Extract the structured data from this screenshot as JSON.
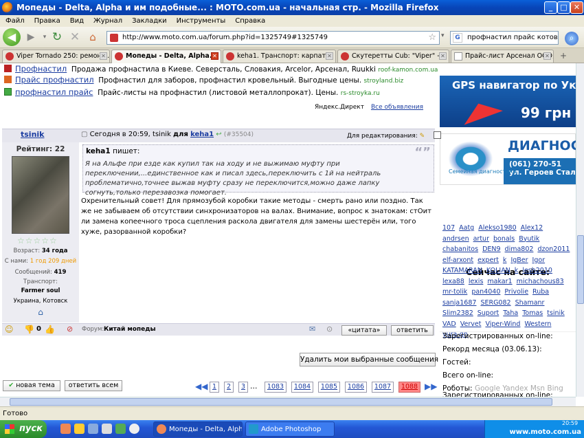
{
  "window": {
    "title": "Мопеды - Delta, Alpha и им подобные... : MOTO.com.ua - начальная стр. - Mozilla Firefox",
    "min": "_",
    "max": "□",
    "close": "✕"
  },
  "menu": [
    "Файл",
    "Правка",
    "Вид",
    "Журнал",
    "Закладки",
    "Инструменты",
    "Справка"
  ],
  "nav": {
    "url": "http://www.moto.com.ua/forum.php?id=1325749#1325749",
    "search": "профнастил прайс котовск",
    "search_engine": "G"
  },
  "tabs": [
    {
      "label": "Viper Tornado 250: ремонт..."
    },
    {
      "label": "Мопеды - Delta, Alpha..."
    },
    {
      "label": "keha1. Транспорт: карпат..."
    },
    {
      "label": "Скутеретты Cub: \"Viper\" -..."
    },
    {
      "label": "Прайс-лист Арсенал ООО,..."
    }
  ],
  "tab_new": "+",
  "ads": [
    {
      "link": "Профнастил",
      "text": "Продажа профнастила в Киеве. Северсталь, Словакия, Arcelor, Арсенал, Ruukki",
      "src": "roof-kamon.com.ua"
    },
    {
      "link": "Прайс профнастил",
      "text": "Профнастил для заборов, профнастил кровельный. Выгодные цены.",
      "src": "stroyland.biz"
    },
    {
      "link": "профнастил прайс",
      "text": "Прайс-листы на профнастил (листовой металлопрокат). Цены.",
      "src": "rs-stroyka.ru"
    }
  ],
  "direct": {
    "label": "Яндекс.Директ",
    "all": "Все объявления"
  },
  "banners": {
    "gps_title": "GPS навигатор по Ук",
    "gps_price": "99 грн",
    "diag_title": "ДИАГНОС",
    "diag_phone": "(061) 270-51",
    "diag_addr": "ул. Героев Стали",
    "diag_sub": "Семейная диагностики"
  },
  "post": {
    "author": "tsinik",
    "date_prefix": "Сегодня в 20:59, tsinik",
    "for": "для",
    "to": "keha1",
    "id": "(#35504)",
    "edit_label": "Для редактирования:",
    "rating_label": "Рейтинг:",
    "rating": "22",
    "stars": "☆☆☆☆☆",
    "age_label": "Возраст:",
    "age": "34 года",
    "since_label": "С нами:",
    "since": "1 год 209 дней",
    "msgs_label": "Сообщений:",
    "msgs": "419",
    "transport_label": "Транспорт:",
    "transport": "Farmer soul",
    "location": "Украина, Котовск",
    "quote_author": "keha1",
    "quote_said": "пишет:",
    "quote_text": "Я на Альфе при езде как купил так на ходу и не выжимаю муфту при переключении,...единственное как и писал здесь,переключить с 1й на нейтраль проблематично,точнее выжав муфту сразу не переключится,можно даже лапку согнуть,только перезавозка помогает.",
    "text": "Охренительный совет! Для прямозубой коробки такие методы - смерть рано или поздно. Так же не забываем об отсутствии синхронизаторов на валах. Внимание, вопрос к знатокам: стОит ли замена копеечного троса сцепления раскола двигателя для замены шестерён или, того хуже, разорванной коробки?",
    "votes": "0",
    "forum_label": "Форум:",
    "forum": "Китай мопеды",
    "btn_quote": "«цитата»",
    "btn_reply": "ответить"
  },
  "delete_btn": "Удалить мои выбранные сообщения",
  "bottom_buttons": {
    "new_topic": "новая тема",
    "reply_all": "ответить всем"
  },
  "pager": [
    "1",
    "2",
    "3",
    "...",
    "1083",
    "1084",
    "1085",
    "1086",
    "1087",
    "1088"
  ],
  "online": {
    "header": "Сейчас на сайте:",
    "users": [
      "107",
      "Aatg",
      "Alekso1980",
      "Alex12",
      "andrsen",
      "artur",
      "bonals",
      "Byutik",
      "chabanitos",
      "DEN9",
      "dima802",
      "dzon2011",
      "elf-arxont",
      "expert",
      "k",
      "IgBer",
      "Igor",
      "KATAMARAN",
      "KOLIAN",
      "k",
      "lesh2010",
      "lexa88",
      "lexis",
      "makar1",
      "michachous83",
      "mr-tolik",
      "pan4040",
      "Privolie",
      "Ruba",
      "sanja1687",
      "SERG082",
      "Shamanr",
      "Slim2382",
      "Suport",
      "Taha",
      "Tomas",
      "tsinik",
      "VAD",
      "Vervet",
      "Viper-Wind",
      "Western",
      "yura-gn"
    ],
    "registered": "Зарегистрированных on-line:",
    "record": "Рекорд месяца (03.06.13):",
    "guests": "Гостей:",
    "total": "Всего on-line:",
    "robots": "Роботы:",
    "robot_list": "Google  Yandex  Msn  Bing"
  },
  "status": "Готово",
  "taskbar": {
    "start": "пуск",
    "tasks": [
      "Мопеды - Delta, Alph...",
      "Adobe Photoshop"
    ],
    "watermark": "www.moto.com.ua",
    "time": "20:59"
  }
}
